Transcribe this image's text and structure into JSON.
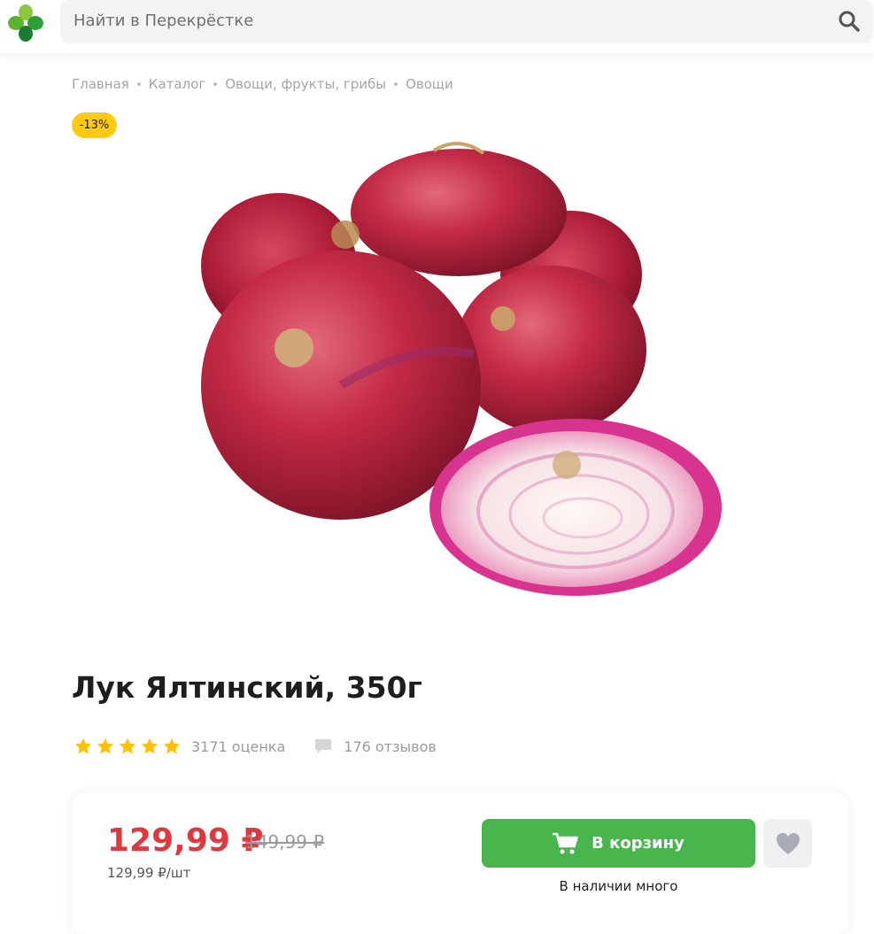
{
  "header": {
    "search_placeholder": "Найти в Перекрёстке"
  },
  "breadcrumb": [
    "Главная",
    "Каталог",
    "Овощи, фрукты, грибы",
    "Овощи"
  ],
  "product": {
    "discount_badge": "-13%",
    "title": "Лук Ялтинский, 350г",
    "rating_stars": 5,
    "ratings_count_text": "3171 оценка",
    "reviews_text": "176 отзывов"
  },
  "price": {
    "current": "129,99 ₽",
    "old": "149,99 ₽",
    "per_unit": "129,99 ₽/шт"
  },
  "actions": {
    "cart_label": "В корзину",
    "availability": "В наличии много"
  },
  "colors": {
    "brand_green": "#48b64d",
    "price_red": "#e0383e",
    "badge_yellow": "#ffca10",
    "star_yellow": "#ffc107"
  }
}
